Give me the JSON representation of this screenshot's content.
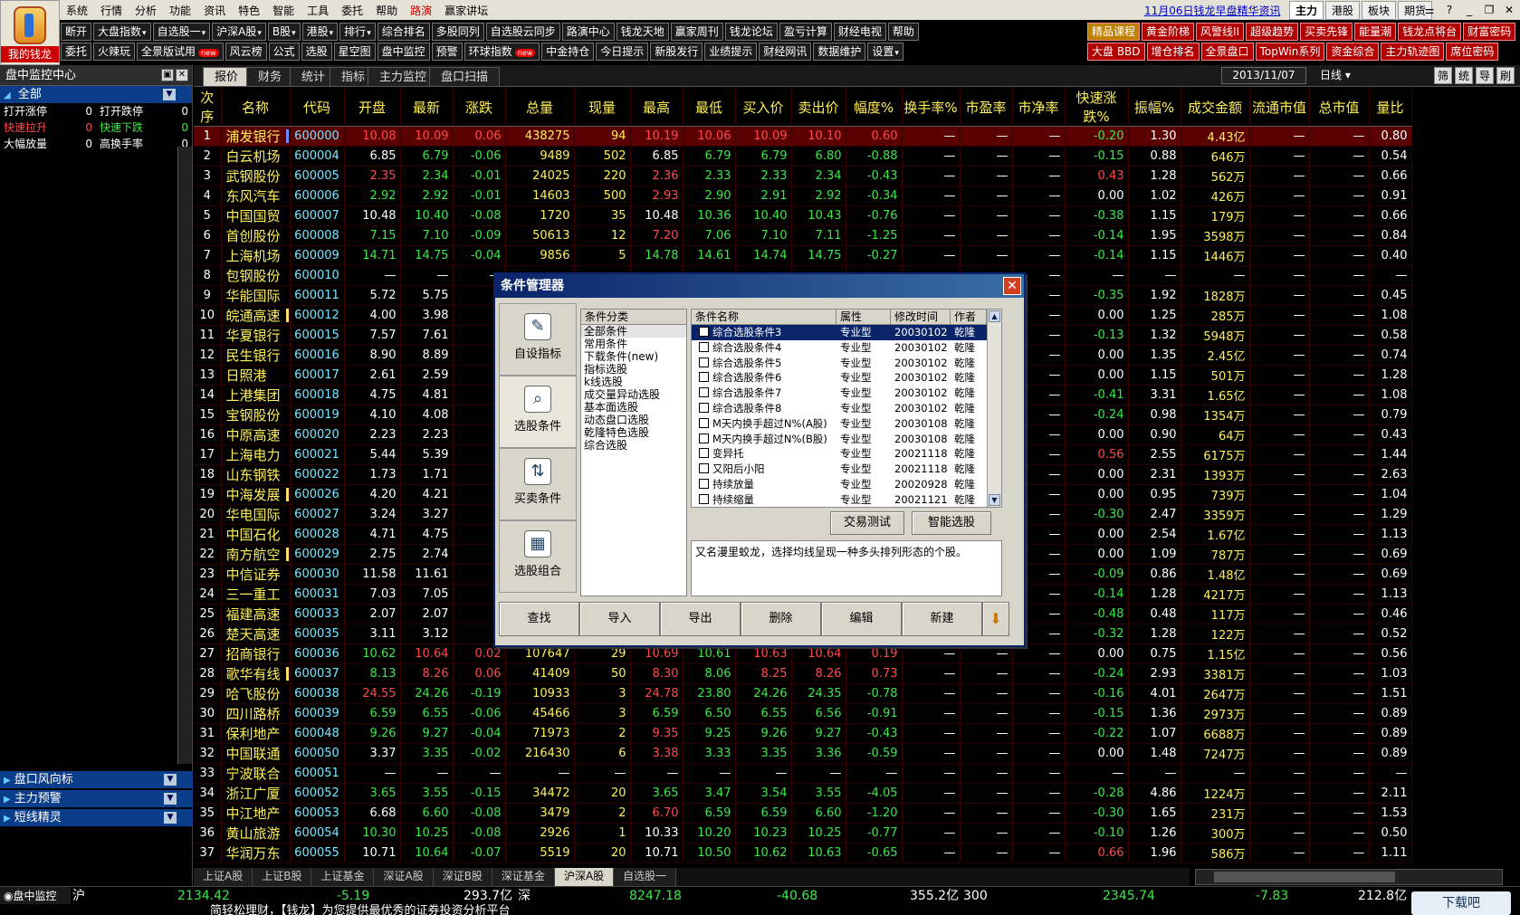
{
  "logo": {
    "text": "我的钱龙"
  },
  "menu": {
    "items": [
      "系统",
      "行情",
      "分析",
      "功能",
      "资讯",
      "特色",
      "智能",
      "工具",
      "委托",
      "帮助",
      "路演",
      "赢家讲坛"
    ],
    "highlight_index": 10,
    "news_link": "11月06日钱龙早盘精华资讯",
    "market_tabs": [
      "主力",
      "港股",
      "板块",
      "期货"
    ],
    "window_controls": [
      "⚌",
      "?",
      "_",
      "❐",
      "✕"
    ]
  },
  "toolbar1": [
    {
      "label": "断开"
    },
    {
      "label": "大盘指数",
      "dd": true
    },
    {
      "label": "自选股一",
      "dd": true
    },
    {
      "label": "沪深A股",
      "dd": true
    },
    {
      "label": "B股",
      "dd": true
    },
    {
      "label": "港股",
      "dd": true
    },
    {
      "label": "排行",
      "dd": true
    },
    {
      "label": "综合排名"
    },
    {
      "label": "多股同列"
    },
    {
      "label": "自选股云同步"
    },
    {
      "label": "路演中心"
    },
    {
      "label": "钱龙天地"
    },
    {
      "label": "赢家周刊"
    },
    {
      "label": "钱龙论坛"
    },
    {
      "label": "盈亏计算"
    },
    {
      "label": "财经电视"
    },
    {
      "label": "帮助"
    }
  ],
  "toolbar2": [
    {
      "label": "委托"
    },
    {
      "label": "火辣玩"
    },
    {
      "label": "全景版试用",
      "new": true
    },
    {
      "label": "风云榜"
    },
    {
      "label": "公式"
    },
    {
      "label": "选股"
    },
    {
      "label": "星空图"
    },
    {
      "label": "盘中监控"
    },
    {
      "label": "预警"
    },
    {
      "label": "环球指数",
      "new": true
    },
    {
      "label": "中金持仓"
    },
    {
      "label": "今日提示"
    },
    {
      "label": "新股发行"
    },
    {
      "label": "业绩提示"
    },
    {
      "label": "财经网讯"
    },
    {
      "label": "数据维护"
    },
    {
      "label": "设置",
      "dd": true
    }
  ],
  "right_toolbar1": [
    "精品课程",
    "黄金阶梯",
    "风警线II",
    "超级趋势",
    "买卖先锋",
    "能量潮",
    "钱龙点将台",
    "财富密码"
  ],
  "right_toolbar2": [
    "大盘 BBD",
    "增仓排名",
    "全景盘口",
    "TopWin系列",
    "资金综合",
    "主力轨迹图",
    "席位密码"
  ],
  "new_badge": "new",
  "left_panel": {
    "title": "盘中监控中心",
    "category": "全部",
    "stats": [
      [
        {
          "label": "打开涨停",
          "value": "0"
        },
        {
          "label": "打开跌停",
          "value": "0"
        }
      ],
      [
        {
          "label": "快速拉升",
          "value": "0"
        },
        {
          "label": "快速下跌",
          "value": "0"
        }
      ],
      [
        {
          "label": "大幅放量",
          "value": "0"
        },
        {
          "label": "高换手率",
          "value": "0"
        }
      ]
    ],
    "bottom_categories": [
      "盘口风向标",
      "主力预警",
      "短线精灵"
    ],
    "colors": {
      "stat_red": "#ff4a4a",
      "stat_green": "#3ee64a",
      "stat_white": "#ffffff"
    }
  },
  "view_tabs": [
    "报价",
    "财务",
    "统计",
    "指标",
    "主力监控",
    "盘口扫描"
  ],
  "date": "2013/11/07",
  "period": "日线",
  "side_buttons": [
    "筛",
    "统",
    "导",
    "刷"
  ],
  "columns": [
    "次序",
    "名称",
    "代码",
    "开盘",
    "最新",
    "涨跌",
    "总量",
    "现量",
    "最高",
    "最低",
    "买入价",
    "卖出价",
    "幅度%",
    "换手率%",
    "市盈率",
    "市净率",
    "快速涨跌%",
    "振幅%",
    "成交金额",
    "流通市值",
    "总市值",
    "量比"
  ],
  "dash": "—",
  "rows": [
    [
      "1",
      "浦发银行",
      "600000",
      "10.08",
      "10.09",
      "0.06",
      "438275",
      "94",
      "10.19",
      "10.06",
      "10.09",
      "10.10",
      "0.60",
      "—",
      "—",
      "—",
      "-0.20",
      "1.30",
      "4.43亿",
      "—",
      "—",
      "0.80"
    ],
    [
      "2",
      "白云机场",
      "600004",
      "6.85",
      "6.79",
      "-0.06",
      "9489",
      "502",
      "6.85",
      "6.79",
      "6.79",
      "6.80",
      "-0.88",
      "—",
      "—",
      "—",
      "-0.15",
      "0.88",
      "646万",
      "—",
      "—",
      "0.54"
    ],
    [
      "3",
      "武钢股份",
      "600005",
      "2.35",
      "2.34",
      "-0.01",
      "24025",
      "220",
      "2.36",
      "2.33",
      "2.33",
      "2.34",
      "-0.43",
      "—",
      "—",
      "—",
      "0.43",
      "1.28",
      "562万",
      "—",
      "—",
      "0.66"
    ],
    [
      "4",
      "东风汽车",
      "600006",
      "2.92",
      "2.92",
      "-0.01",
      "14603",
      "500",
      "2.93",
      "2.90",
      "2.91",
      "2.92",
      "-0.34",
      "—",
      "—",
      "—",
      "0.00",
      "1.02",
      "426万",
      "—",
      "—",
      "0.91"
    ],
    [
      "5",
      "中国国贸",
      "600007",
      "10.48",
      "10.40",
      "-0.08",
      "1720",
      "35",
      "10.48",
      "10.36",
      "10.40",
      "10.43",
      "-0.76",
      "—",
      "—",
      "—",
      "-0.38",
      "1.15",
      "179万",
      "—",
      "—",
      "0.66"
    ],
    [
      "6",
      "首创股份",
      "600008",
      "7.15",
      "7.10",
      "-0.09",
      "50613",
      "12",
      "7.20",
      "7.06",
      "7.10",
      "7.11",
      "-1.25",
      "—",
      "—",
      "—",
      "-0.14",
      "1.95",
      "3598万",
      "—",
      "—",
      "0.84"
    ],
    [
      "7",
      "上海机场",
      "600009",
      "14.71",
      "14.75",
      "-0.04",
      "9856",
      "5",
      "14.78",
      "14.61",
      "14.74",
      "14.75",
      "-0.27",
      "—",
      "—",
      "—",
      "-0.14",
      "1.15",
      "1446万",
      "—",
      "—",
      "0.40"
    ],
    [
      "8",
      "包钢股份",
      "600010",
      "—",
      "—",
      "—",
      "—",
      "—",
      "—",
      "—",
      "—",
      "—",
      "—",
      "—",
      "—",
      "—",
      "—",
      "—",
      "—",
      "—",
      "—",
      "—"
    ],
    [
      "9",
      "华能国际",
      "600011",
      "5.72",
      "5.75",
      "",
      "",
      "",
      "",
      "",
      "",
      "",
      "",
      "—",
      "—",
      "—",
      "-0.35",
      "1.92",
      "1828万",
      "—",
      "—",
      "0.45"
    ],
    [
      "10",
      "皖通高速",
      "600012",
      "4.00",
      "3.98",
      "",
      "",
      "",
      "",
      "",
      "",
      "",
      "",
      "—",
      "—",
      "—",
      "0.00",
      "1.25",
      "285万",
      "—",
      "—",
      "1.08"
    ],
    [
      "11",
      "华夏银行",
      "600015",
      "7.57",
      "7.61",
      "",
      "",
      "",
      "",
      "",
      "",
      "",
      "",
      "—",
      "—",
      "—",
      "-0.13",
      "1.32",
      "5948万",
      "—",
      "—",
      "0.58"
    ],
    [
      "12",
      "民生银行",
      "600016",
      "8.90",
      "8.89",
      "",
      "",
      "",
      "",
      "",
      "",
      "",
      "",
      "—",
      "—",
      "—",
      "0.00",
      "1.35",
      "2.45亿",
      "—",
      "—",
      "0.74"
    ],
    [
      "13",
      "日照港",
      "600017",
      "2.61",
      "2.59",
      "",
      "",
      "",
      "",
      "",
      "",
      "",
      "",
      "—",
      "—",
      "—",
      "0.00",
      "1.15",
      "501万",
      "—",
      "—",
      "1.28"
    ],
    [
      "14",
      "上港集团",
      "600018",
      "4.75",
      "4.81",
      "",
      "",
      "",
      "",
      "",
      "",
      "",
      "",
      "—",
      "—",
      "—",
      "-0.41",
      "3.31",
      "1.65亿",
      "—",
      "—",
      "1.08"
    ],
    [
      "15",
      "宝钢股份",
      "600019",
      "4.10",
      "4.08",
      "",
      "",
      "",
      "",
      "",
      "",
      "",
      "",
      "—",
      "—",
      "—",
      "-0.24",
      "0.98",
      "1354万",
      "—",
      "—",
      "0.79"
    ],
    [
      "16",
      "中原高速",
      "600020",
      "2.23",
      "2.23",
      "",
      "",
      "",
      "",
      "",
      "",
      "",
      "",
      "—",
      "—",
      "—",
      "0.00",
      "0.90",
      "64万",
      "—",
      "—",
      "0.43"
    ],
    [
      "17",
      "上海电力",
      "600021",
      "5.44",
      "5.39",
      "",
      "",
      "",
      "",
      "",
      "",
      "",
      "",
      "—",
      "—",
      "—",
      "0.56",
      "2.55",
      "6175万",
      "—",
      "—",
      "1.44"
    ],
    [
      "18",
      "山东钢铁",
      "600022",
      "1.73",
      "1.71",
      "",
      "",
      "",
      "",
      "",
      "",
      "",
      "",
      "—",
      "—",
      "—",
      "0.00",
      "2.31",
      "1393万",
      "—",
      "—",
      "2.63"
    ],
    [
      "19",
      "中海发展",
      "600026",
      "4.20",
      "4.21",
      "",
      "",
      "",
      "",
      "",
      "",
      "",
      "",
      "—",
      "—",
      "—",
      "0.00",
      "0.95",
      "739万",
      "—",
      "—",
      "1.04"
    ],
    [
      "20",
      "华电国际",
      "600027",
      "3.24",
      "3.27",
      "",
      "",
      "",
      "",
      "",
      "",
      "",
      "",
      "—",
      "—",
      "—",
      "-0.30",
      "2.47",
      "3359万",
      "—",
      "—",
      "1.29"
    ],
    [
      "21",
      "中国石化",
      "600028",
      "4.71",
      "4.75",
      "",
      "",
      "",
      "",
      "",
      "",
      "",
      "",
      "—",
      "—",
      "—",
      "0.00",
      "2.54",
      "1.67亿",
      "—",
      "—",
      "1.13"
    ],
    [
      "22",
      "南方航空",
      "600029",
      "2.75",
      "2.74",
      "",
      "",
      "",
      "",
      "",
      "",
      "",
      "",
      "—",
      "—",
      "—",
      "0.00",
      "1.09",
      "787万",
      "—",
      "—",
      "0.69"
    ],
    [
      "23",
      "中信证券",
      "600030",
      "11.58",
      "11.61",
      "",
      "",
      "",
      "",
      "",
      "",
      "",
      "",
      "—",
      "—",
      "—",
      "-0.09",
      "0.86",
      "1.48亿",
      "—",
      "—",
      "0.69"
    ],
    [
      "24",
      "三一重工",
      "600031",
      "7.03",
      "7.05",
      "",
      "",
      "",
      "",
      "",
      "",
      "",
      "",
      "—",
      "—",
      "—",
      "-0.14",
      "1.28",
      "4217万",
      "—",
      "—",
      "1.13"
    ],
    [
      "25",
      "福建高速",
      "600033",
      "2.07",
      "2.07",
      "",
      "",
      "",
      "",
      "",
      "",
      "",
      "",
      "—",
      "—",
      "—",
      "-0.48",
      "0.48",
      "117万",
      "—",
      "—",
      "0.46"
    ],
    [
      "26",
      "楚天高速",
      "600035",
      "3.11",
      "3.12",
      "",
      "",
      "",
      "",
      "",
      "",
      "",
      "",
      "—",
      "—",
      "—",
      "-0.32",
      "1.28",
      "122万",
      "—",
      "—",
      "0.52"
    ],
    [
      "27",
      "招商银行",
      "600036",
      "10.62",
      "10.64",
      "0.02",
      "107647",
      "29",
      "10.69",
      "10.61",
      "10.63",
      "10.64",
      "0.19",
      "—",
      "—",
      "—",
      "0.00",
      "0.75",
      "1.15亿",
      "—",
      "—",
      "0.56"
    ],
    [
      "28",
      "歌华有线",
      "600037",
      "8.13",
      "8.26",
      "0.06",
      "41409",
      "50",
      "8.30",
      "8.06",
      "8.25",
      "8.26",
      "0.73",
      "—",
      "—",
      "—",
      "-0.24",
      "2.93",
      "3381万",
      "—",
      "—",
      "1.03"
    ],
    [
      "29",
      "哈飞股份",
      "600038",
      "24.55",
      "24.26",
      "-0.19",
      "10933",
      "3",
      "24.78",
      "23.80",
      "24.26",
      "24.35",
      "-0.78",
      "—",
      "—",
      "—",
      "-0.16",
      "4.01",
      "2647万",
      "—",
      "—",
      "1.51"
    ],
    [
      "30",
      "四川路桥",
      "600039",
      "6.59",
      "6.55",
      "-0.06",
      "45466",
      "3",
      "6.59",
      "6.50",
      "6.55",
      "6.56",
      "-0.91",
      "—",
      "—",
      "—",
      "-0.15",
      "1.36",
      "2973万",
      "—",
      "—",
      "0.89"
    ],
    [
      "31",
      "保利地产",
      "600048",
      "9.26",
      "9.27",
      "-0.04",
      "71973",
      "2",
      "9.35",
      "9.25",
      "9.26",
      "9.27",
      "-0.43",
      "—",
      "—",
      "—",
      "-0.22",
      "1.07",
      "6688万",
      "—",
      "—",
      "0.89"
    ],
    [
      "32",
      "中国联通",
      "600050",
      "3.37",
      "3.35",
      "-0.02",
      "216430",
      "6",
      "3.38",
      "3.33",
      "3.35",
      "3.36",
      "-0.59",
      "—",
      "—",
      "—",
      "0.00",
      "1.48",
      "7247万",
      "—",
      "—",
      "0.89"
    ],
    [
      "33",
      "宁波联合",
      "600051",
      "—",
      "—",
      "—",
      "—",
      "—",
      "—",
      "—",
      "—",
      "—",
      "—",
      "—",
      "—",
      "—",
      "—",
      "—",
      "—",
      "—",
      "—",
      "—"
    ],
    [
      "34",
      "浙江广厦",
      "600052",
      "3.65",
      "3.55",
      "-0.15",
      "34472",
      "20",
      "3.65",
      "3.47",
      "3.54",
      "3.55",
      "-4.05",
      "—",
      "—",
      "—",
      "-0.28",
      "4.86",
      "1224万",
      "—",
      "—",
      "2.11"
    ],
    [
      "35",
      "中江地产",
      "600053",
      "6.68",
      "6.60",
      "-0.08",
      "3479",
      "2",
      "6.70",
      "6.59",
      "6.59",
      "6.60",
      "-1.20",
      "—",
      "—",
      "—",
      "-0.30",
      "1.65",
      "231万",
      "—",
      "—",
      "1.53"
    ],
    [
      "36",
      "黄山旅游",
      "600054",
      "10.30",
      "10.25",
      "-0.08",
      "2926",
      "1",
      "10.33",
      "10.20",
      "10.23",
      "10.25",
      "-0.77",
      "—",
      "—",
      "—",
      "-0.10",
      "1.26",
      "300万",
      "—",
      "—",
      "0.50"
    ],
    [
      "37",
      "华润万东",
      "600055",
      "10.71",
      "10.64",
      "-0.07",
      "5519",
      "20",
      "10.71",
      "10.50",
      "10.62",
      "10.63",
      "-0.65",
      "—",
      "—",
      "—",
      "0.66",
      "1.96",
      "586万",
      "—",
      "—",
      "1.11"
    ]
  ],
  "bottom_tabs": [
    "上证A股",
    "上证B股",
    "上证基金",
    "深证A股",
    "深证B股",
    "深证基金",
    "沪深A股",
    "自选股一"
  ],
  "bottom_tab_active": 6,
  "status_bar": {
    "label": "盘中监控",
    "sh": {
      "name": "沪",
      "index": "2134.42",
      "change": "-5.19",
      "amount": "293.7亿"
    },
    "sz": {
      "name": "深",
      "index": "8247.18",
      "change": "-40.68",
      "amount": "355.2亿"
    },
    "hs300": {
      "name": "300",
      "index": "2345.74",
      "change": "-7.83",
      "amount": "212.8亿"
    }
  },
  "ticker": "简轻松理财，【钱龙】为您提供最优秀的证券投资分析平台",
  "dialog": {
    "title": "条件管理器",
    "close": "✕",
    "side_buttons": [
      {
        "label": "自设指标",
        "icon": "✎"
      },
      {
        "label": "选股条件",
        "icon": "⌕"
      },
      {
        "label": "买卖条件",
        "icon": "⇅"
      },
      {
        "label": "选股组合",
        "icon": "▦"
      }
    ],
    "side_active": 1,
    "category_header": "条件分类",
    "categories": [
      "全部条件",
      "常用条件",
      "下载条件(new)",
      "指标选股",
      "k线选股",
      "成交量异动选股",
      "基本面选股",
      "动态盘口选股",
      "乾隆特色选股",
      "综合选股"
    ],
    "list_headers": [
      "条件名称",
      "属性",
      "修改时间",
      "作者"
    ],
    "conditions": [
      [
        "综合选股条件3",
        "专业型",
        "20030102",
        "乾隆"
      ],
      [
        "综合选股条件4",
        "专业型",
        "20030102",
        "乾隆"
      ],
      [
        "综合选股条件5",
        "专业型",
        "20030102",
        "乾隆"
      ],
      [
        "综合选股条件6",
        "专业型",
        "20030102",
        "乾隆"
      ],
      [
        "综合选股条件7",
        "专业型",
        "20030102",
        "乾隆"
      ],
      [
        "综合选股条件8",
        "专业型",
        "20030102",
        "乾隆"
      ],
      [
        "M天内换手超过N%(A股)",
        "专业型",
        "20030108",
        "乾隆"
      ],
      [
        "M天内换手超过N%(B股)",
        "专业型",
        "20030108",
        "乾隆"
      ],
      [
        "变异托",
        "专业型",
        "20021118",
        "乾隆"
      ],
      [
        "又阳后小阳",
        "专业型",
        "20021118",
        "乾隆"
      ],
      [
        "持续放量",
        "专业型",
        "20020928",
        "乾隆"
      ],
      [
        "持续缩量",
        "专业型",
        "20021121",
        "乾隆"
      ]
    ],
    "buttons": {
      "test": "交易测试",
      "smart": "智能选股"
    },
    "description": "又名漫里蛟龙，选择均线呈现一种多头排列形态的个股。",
    "footer": [
      "查找",
      "导入",
      "导出",
      "删除",
      "编辑",
      "新建"
    ]
  },
  "watermark": "下载吧"
}
